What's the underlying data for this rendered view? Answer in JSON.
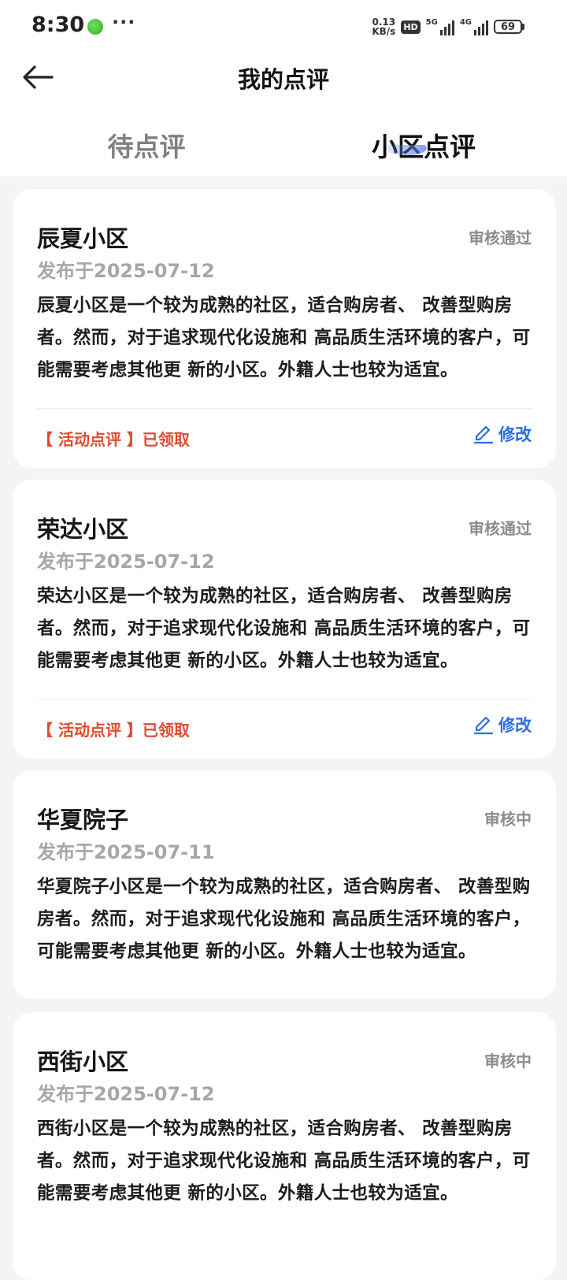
{
  "status_bar": {
    "time": "8:30",
    "more": "···",
    "net_speed_value": "0.13",
    "net_speed_unit": "KB/s",
    "hd_label": "HD",
    "sim1_label": "5G",
    "sim2_label": "4G",
    "battery": "69"
  },
  "nav": {
    "title": "我的点评"
  },
  "tabs": {
    "pending": "待点评",
    "community": "小区点评",
    "active": "community"
  },
  "reviews": [
    {
      "title": "辰夏小区",
      "status": "审核通过",
      "date": "发布于2025-07-12",
      "body": "辰夏小区是一个较为成熟的社区，适合购房者、 改善型购房者。然而，对于追求现代化设施和 高品质生活环境的客户，可能需要考虑其他更 新的小区。外籍人士也较为适宜。",
      "tag": "【 活动点评 】已领取",
      "edit_label": "修改"
    },
    {
      "title": "荣达小区",
      "status": "审核通过",
      "date": "发布于2025-07-12",
      "body": "荣达小区是一个较为成熟的社区，适合购房者、 改善型购房者。然而，对于追求现代化设施和 高品质生活环境的客户，可能需要考虑其他更 新的小区。外籍人士也较为适宜。",
      "tag": "【 活动点评 】已领取",
      "edit_label": "修改"
    },
    {
      "title": "华夏院子",
      "status": "审核中",
      "date": "发布于2025-07-11",
      "body": "华夏院子小区是一个较为成熟的社区，适合购房者、 改善型购房者。然而，对于追求现代化设施和 高品质生活环境的客户，可能需要考虑其他更 新的小区。外籍人士也较为适宜。"
    },
    {
      "title": "西街小区",
      "status": "审核中",
      "date": "发布于2025-07-12",
      "body": "西街小区是一个较为成熟的社区，适合购房者、 改善型购房者。然而，对于追求现代化设施和 高品质生活环境的客户，可能需要考虑其他更 新的小区。外籍人士也较为适宜。"
    }
  ],
  "colors": {
    "accent_blue": "#2b6ce6",
    "tag_red": "#e04a2f",
    "status_gray": "#8c8c8c",
    "background": "#f4f4f4"
  },
  "icons": {
    "back": "arrow-left-icon",
    "edit": "pencil-icon"
  }
}
